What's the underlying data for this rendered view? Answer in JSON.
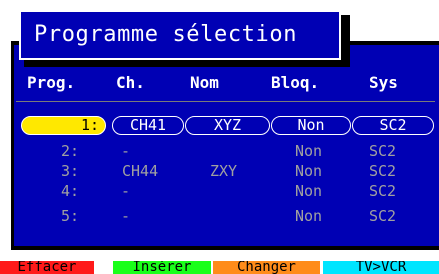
{
  "menu": {
    "title": "Programme sélection"
  },
  "table": {
    "headers": {
      "prog": "Prog.",
      "ch": "Ch.",
      "nom": "Nom",
      "bloq": "Bloq.",
      "sys": "Sys"
    },
    "rows": [
      {
        "prog": "1:",
        "ch": "CH41",
        "nom": "XYZ",
        "bloq": "Non",
        "sys": "SC2"
      },
      {
        "prog": "2:",
        "ch": "-",
        "nom": "",
        "bloq": "Non",
        "sys": "SC2"
      },
      {
        "prog": "3:",
        "ch": "CH44",
        "nom": "ZXY",
        "bloq": "Non",
        "sys": "SC2"
      },
      {
        "prog": "4:",
        "ch": "-",
        "nom": "",
        "bloq": "Non",
        "sys": "SC2"
      },
      {
        "prog": "5:",
        "ch": "-",
        "nom": "",
        "bloq": "Non",
        "sys": "SC2"
      }
    ]
  },
  "buttons": {
    "effacer": "Effacer",
    "inserer": "Insérer",
    "changer": "Changer",
    "tv_vcr": "TV>VCR"
  },
  "colors": {
    "panel_background": "#0000b4",
    "selection_highlight": "#ffe800",
    "button_red": "#ff1a1a",
    "button_green": "#1aff1a",
    "button_orange": "#ff8c1a",
    "button_cyan": "#00e5ff"
  }
}
